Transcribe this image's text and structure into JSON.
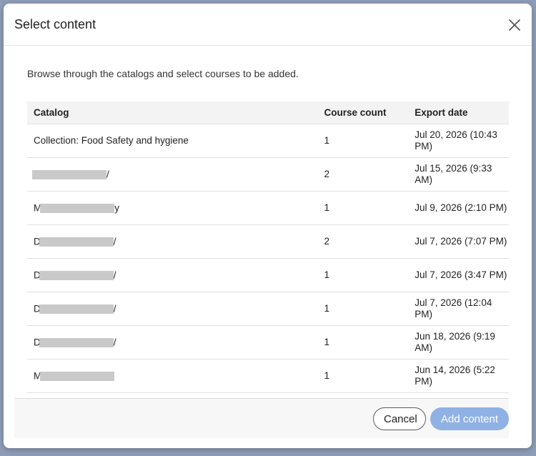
{
  "dialog": {
    "title": "Select content",
    "close_label": "×",
    "description": "Browse through the catalogs and select courses to be added."
  },
  "table": {
    "headers": {
      "catalog": "Catalog",
      "count": "Course count",
      "date": "Export date"
    },
    "rows": [
      {
        "catalog": "Collection: Food Safety and hygiene",
        "redacted": false,
        "count": "1",
        "date": "Jul 20, 2026 (10:43 PM)"
      },
      {
        "catalog": "",
        "suffix": "/",
        "prefix": "",
        "redacted": true,
        "count": "2",
        "date": "Jul 15, 2026 (9:33 AM)"
      },
      {
        "catalog": "",
        "prefix": "M",
        "suffix": "y",
        "redacted": true,
        "count": "1",
        "date": "Jul 9, 2026 (2:10 PM)"
      },
      {
        "catalog": "",
        "prefix": "D",
        "suffix": "/",
        "redacted": true,
        "count": "2",
        "date": "Jul 7, 2026 (7:07 PM)"
      },
      {
        "catalog": "",
        "prefix": "D",
        "suffix": "/",
        "redacted": true,
        "count": "1",
        "date": "Jul 7, 2026 (3:47 PM)"
      },
      {
        "catalog": "",
        "prefix": "D",
        "suffix": "/",
        "redacted": true,
        "count": "1",
        "date": "Jul 7, 2026 (12:04 PM)"
      },
      {
        "catalog": "",
        "prefix": "D",
        "suffix": "/",
        "redacted": true,
        "count": "1",
        "date": "Jun 18, 2026 (9:19 AM)"
      },
      {
        "catalog": "",
        "prefix": "M",
        "suffix": "",
        "redacted": true,
        "count": "1",
        "date": "Jun 14, 2026 (5:22 PM)"
      }
    ]
  },
  "footer": {
    "cancel_label": "Cancel",
    "add_label": "Add content"
  },
  "colors": {
    "primary_disabled": "#8fb1e4",
    "backdrop": "#8d9cb7"
  }
}
